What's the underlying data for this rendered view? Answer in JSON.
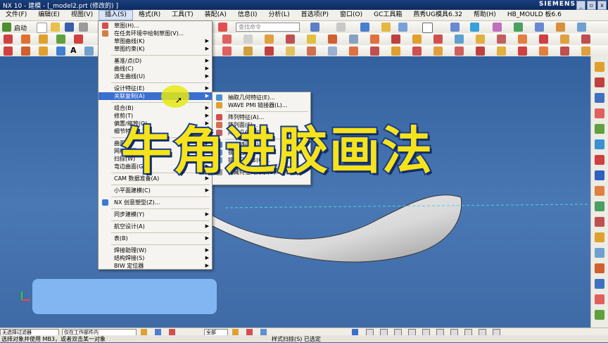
{
  "window": {
    "title": "NX 10 - 建模 - [_model2.prt  (修改的) ]",
    "brand": "SIEMENS",
    "buttons": {
      "minimize": "_",
      "restore": "▫",
      "close": "x"
    }
  },
  "menubar": {
    "items": [
      "文件(F)",
      "编辑(E)",
      "视图(V)",
      "插入(S)",
      "格式(R)",
      "工具(T)",
      "装配(A)",
      "信息(I)",
      "分析(L)",
      "首选项(P)",
      "窗口(O)",
      "GC工具箱",
      "燕秀UG模具6.32",
      "帮助(H)",
      "HB_MOULD 板6.6"
    ]
  },
  "toolbar": {
    "start_label": "启动",
    "search_placeholder": "查找命令"
  },
  "insert_menu": {
    "items": [
      {
        "label": "草图(H)...",
        "arrow": ""
      },
      {
        "label": "在任务环境中绘制草图(V)...",
        "arrow": ""
      },
      {
        "label": "草图曲线(K)",
        "arrow": "▶"
      },
      {
        "label": "草图约束(K)",
        "arrow": "▶"
      },
      {
        "label": "基准/点(D)",
        "arrow": "▶"
      },
      {
        "label": "曲线(C)",
        "arrow": "▶"
      },
      {
        "label": "派生曲线(U)",
        "arrow": "▶"
      },
      {
        "label": "设计特征(E)",
        "arrow": "▶"
      },
      {
        "label": "关联复制(A)",
        "arrow": "▶"
      },
      {
        "label": "组合(B)",
        "arrow": "▶"
      },
      {
        "label": "修剪(T)",
        "arrow": "▶"
      },
      {
        "label": "偏置/缩放(O)",
        "arrow": "▶"
      },
      {
        "label": "细节特征(L)",
        "arrow": "▶"
      },
      {
        "label": "曲面(R)",
        "arrow": "▶"
      },
      {
        "label": "网格曲面(M)",
        "arrow": "▶"
      },
      {
        "label": "扫掠(W)",
        "arrow": "▶"
      },
      {
        "label": "弯边曲面(G)",
        "arrow": "▶"
      },
      {
        "label": "CAM 数据准备(A)",
        "arrow": "▶"
      },
      {
        "label": "小平面建模(C)",
        "arrow": "▶"
      },
      {
        "label": "NX 创意塑型(Z)...",
        "arrow": ""
      },
      {
        "label": "同步建模(Y)",
        "arrow": "▶"
      },
      {
        "label": "航空设计(A)",
        "arrow": "▶"
      },
      {
        "label": "表(B)",
        "arrow": "▶"
      },
      {
        "label": "焊接助理(W)",
        "arrow": "▶"
      },
      {
        "label": "结构焊接(S)",
        "arrow": "▶"
      },
      {
        "label": "BIW 定位器",
        "arrow": "▶"
      }
    ]
  },
  "submenu": {
    "items": [
      "抽取几何特征(E)...",
      "WAVE PMI 链接器(L)...",
      "阵列特征(A)...",
      "阵列面(F)...",
      "阵列几何特征(T)...",
      "镜像特征(R)...",
      "镜像面(M)...",
      "镜像几何体(G)...",
      "隐藏特征的对象(B)..."
    ]
  },
  "overlay_text": "牛角进胶画法",
  "bottombar": {
    "filter_label": "无选择过滤器",
    "scope_label": "仅在工作部件内",
    "snap_label": "全部"
  },
  "statusbar": {
    "left": "选择对象并使用 MB3，或者双击某一对象",
    "right": "样式扫掠(S) 已选定"
  },
  "colors": {
    "accent": "#3a6fcf",
    "viewport": "#3f6aa8",
    "overlay_text": "#f6e31b"
  }
}
